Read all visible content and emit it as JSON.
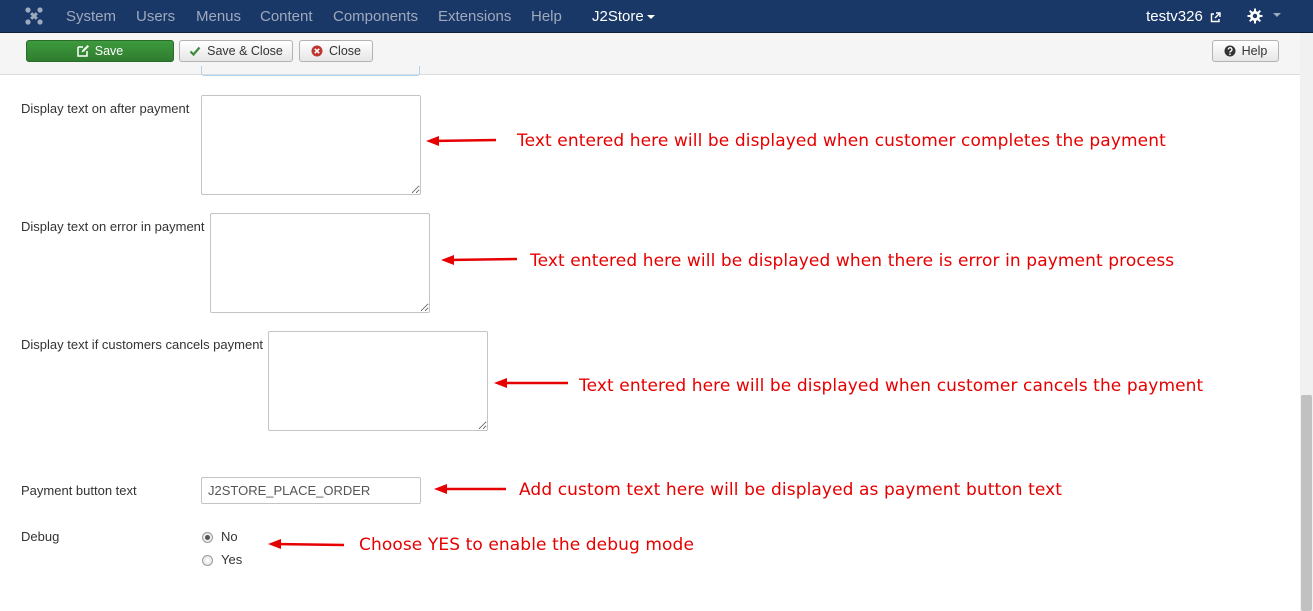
{
  "nav": {
    "logo_icon": "joomla-logo-icon",
    "items": [
      {
        "label": "System"
      },
      {
        "label": "Users"
      },
      {
        "label": "Menus"
      },
      {
        "label": "Content"
      },
      {
        "label": "Components"
      },
      {
        "label": "Extensions"
      },
      {
        "label": "Help"
      },
      {
        "label": "J2Store"
      }
    ],
    "user": "testv326",
    "user_icon": "external-link-icon",
    "settings_icon": "gear-icon"
  },
  "toolbar": {
    "save_label": "Save",
    "save_close_label": "Save & Close",
    "close_label": "Close",
    "help_label": "Help",
    "save_color": "#339933"
  },
  "form": {
    "after_payment_label": "Display text on after payment",
    "error_payment_label": "Display text on error in payment",
    "cancel_payment_label": "Display text if customers cancels payment",
    "payment_button_label": "Payment button text",
    "payment_button_value": "J2STORE_PLACE_ORDER",
    "debug_label": "Debug",
    "debug_options": [
      {
        "label": "No",
        "checked": true
      },
      {
        "label": "Yes",
        "checked": false
      }
    ]
  },
  "annotations": {
    "color": "#e60000",
    "after_payment": "Text entered here will be displayed when customer completes the payment",
    "error_payment": "Text entered here will be displayed when there is error in payment process",
    "cancel_payment": "Text entered here will be displayed when customer cancels the payment",
    "payment_button": "Add custom text here will be displayed as payment button text",
    "debug": "Choose YES to enable the debug mode"
  }
}
